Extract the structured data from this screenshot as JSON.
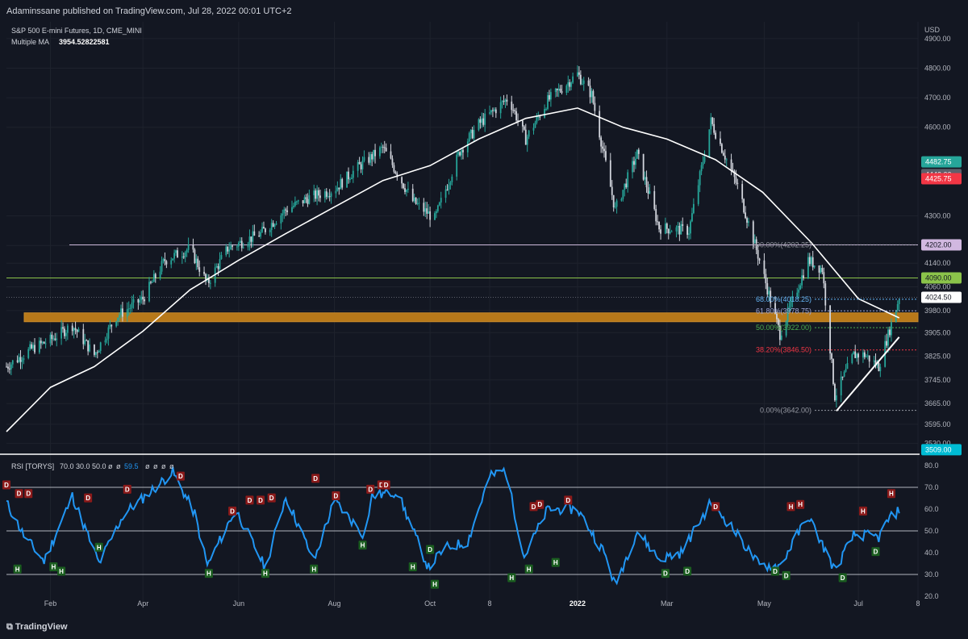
{
  "header": {
    "publisher_line": "Adaminssane published on TradingView.com, Jul 28, 2022 00:01 UTC+2"
  },
  "footer": {
    "logo_text": "TradingView"
  },
  "colors": {
    "background": "#131722",
    "grid": "#1e222d",
    "axis_text": "#b2b5be",
    "up_candle": "#26a69a",
    "down_candle": "#d1d4dc",
    "ma_line": "#ffffff",
    "rsi_line": "#2196f3",
    "zone_fill": "#b8791a",
    "green_level": "#8bc34a",
    "pink_level": "#c8b4d6",
    "fib_0": "#9598a1",
    "fib_382": "#f23645",
    "fib_50": "#4caf50",
    "fib_618": "#9fa8da",
    "fib_68": "#64b5f6"
  },
  "chart_data": [
    {
      "type": "candlestick",
      "title": "S&P 500 E-mini Futures, 1D, CME_MINI",
      "indicator_label": "Multiple MA",
      "indicator_value": "3954.52822581",
      "currency": "USD",
      "ylim": [
        3510,
        4935
      ],
      "y_ticks": [
        "4900.00",
        "4800.00",
        "4700.00",
        "4600.00",
        "4300.00",
        "4200.00",
        "4140.00",
        "4060.00",
        "3980.00",
        "3905.00",
        "3825.00",
        "3745.00",
        "3665.00",
        "3595.00",
        "3530.00"
      ],
      "x_labels": [
        "Feb",
        "Apr",
        "Jun",
        "Aug",
        "Oct",
        "8",
        "2022",
        "Mar",
        "May",
        "Jul",
        "8"
      ],
      "price_badges": [
        {
          "label": "4482.75",
          "value": 4482.75,
          "color": "#26a69a"
        },
        {
          "label": "4440.00",
          "value": 4440.0,
          "color": "#5d606b"
        },
        {
          "label": "4425.75",
          "value": 4425.75,
          "color": "#f23645"
        },
        {
          "label": "4202.00",
          "value": 4202.0,
          "color": "#d1b8e0"
        },
        {
          "label": "4090.00",
          "value": 4090.0,
          "color": "#8bc34a"
        },
        {
          "label": "4024.50",
          "value": 4024.5,
          "color": "#ffffff"
        },
        {
          "label": "3509.00",
          "value": 3509.0,
          "color": "#00bcd4"
        }
      ],
      "horizontal_levels": [
        {
          "value": 4202.0,
          "color": "#c8b4d6"
        },
        {
          "value": 4090.0,
          "color": "#8bc34a"
        },
        {
          "value": 4024.5,
          "color": "#5d606b"
        }
      ],
      "support_zone": {
        "low": 3942,
        "high": 3972
      },
      "fib_levels": [
        {
          "label": "100.00%(4202.25)",
          "value": 4202.25
        },
        {
          "label": "68.00%(4018.25)",
          "value": 4018.25
        },
        {
          "label": "61.80%(3978.75)",
          "value": 3978.75
        },
        {
          "label": "50.00%(3922.00)",
          "value": 3922.0
        },
        {
          "label": "38.20%(3846.50)",
          "value": 3846.5
        },
        {
          "label": "0.00%(3642.00)",
          "value": 3642.0
        }
      ],
      "trendline": {
        "from": {
          "x": "2022-06-17",
          "y": 3640
        },
        "to": {
          "x": "2022-07-27",
          "y": 3890
        }
      },
      "series": [
        {
          "name": "Multiple MA",
          "points": [
            [
              "2021-01-04",
              3570
            ],
            [
              "2021-02-01",
              3720
            ],
            [
              "2021-03-01",
              3790
            ],
            [
              "2021-04-01",
              3910
            ],
            [
              "2021-05-01",
              4050
            ],
            [
              "2021-06-01",
              4150
            ],
            [
              "2021-07-01",
              4240
            ],
            [
              "2021-08-01",
              4330
            ],
            [
              "2021-09-01",
              4420
            ],
            [
              "2021-10-01",
              4470
            ],
            [
              "2021-11-01",
              4560
            ],
            [
              "2021-12-01",
              4630
            ],
            [
              "2022-01-03",
              4665
            ],
            [
              "2022-02-01",
              4600
            ],
            [
              "2022-03-01",
              4560
            ],
            [
              "2022-04-01",
              4490
            ],
            [
              "2022-05-01",
              4380
            ],
            [
              "2022-06-01",
              4210
            ],
            [
              "2022-07-01",
              4020
            ],
            [
              "2022-07-27",
              3955
            ]
          ]
        },
        {
          "name": "Close",
          "points": [
            [
              "2021-01-04",
              3790
            ],
            [
              "2021-01-20",
              3850
            ],
            [
              "2021-02-01",
              3880
            ],
            [
              "2021-02-15",
              3930
            ],
            [
              "2021-03-01",
              3830
            ],
            [
              "2021-03-15",
              3960
            ],
            [
              "2021-04-01",
              4020
            ],
            [
              "2021-04-15",
              4150
            ],
            [
              "2021-05-01",
              4190
            ],
            [
              "2021-05-12",
              4070
            ],
            [
              "2021-05-25",
              4190
            ],
            [
              "2021-06-15",
              4240
            ],
            [
              "2021-07-01",
              4320
            ],
            [
              "2021-07-15",
              4360
            ],
            [
              "2021-08-01",
              4390
            ],
            [
              "2021-08-15",
              4460
            ],
            [
              "2021-09-01",
              4530
            ],
            [
              "2021-09-20",
              4350
            ],
            [
              "2021-10-04",
              4290
            ],
            [
              "2021-10-20",
              4520
            ],
            [
              "2021-11-01",
              4610
            ],
            [
              "2021-11-20",
              4700
            ],
            [
              "2021-12-01",
              4560
            ],
            [
              "2021-12-15",
              4690
            ],
            [
              "2022-01-03",
              4780
            ],
            [
              "2022-01-12",
              4710
            ],
            [
              "2022-01-27",
              4320
            ],
            [
              "2022-02-10",
              4510
            ],
            [
              "2022-02-24",
              4260
            ],
            [
              "2022-03-15",
              4250
            ],
            [
              "2022-03-29",
              4620
            ],
            [
              "2022-04-15",
              4400
            ],
            [
              "2022-04-29",
              4150
            ],
            [
              "2022-05-12",
              3900
            ],
            [
              "2022-05-30",
              4150
            ],
            [
              "2022-06-08",
              4120
            ],
            [
              "2022-06-16",
              3690
            ],
            [
              "2022-06-28",
              3830
            ],
            [
              "2022-07-05",
              3830
            ],
            [
              "2022-07-14",
              3790
            ],
            [
              "2022-07-27",
              4024.5
            ]
          ]
        }
      ]
    },
    {
      "type": "line",
      "title": "RSI [TORYS]",
      "params": [
        "70.0",
        "30.0",
        "50.0",
        "ø",
        "ø"
      ],
      "current_value": "59.5",
      "params_tail": [
        "ø",
        "ø",
        "ø",
        "ø"
      ],
      "ylim": [
        17,
        83
      ],
      "y_ticks": [
        "80.0",
        "70.0",
        "60.0",
        "50.0",
        "40.0",
        "30.0",
        "20.0"
      ],
      "levels": [
        70,
        50,
        30
      ],
      "series": [
        {
          "name": "RSI",
          "points": [
            [
              "2021-01-04",
              63
            ],
            [
              "2021-01-15",
              48
            ],
            [
              "2021-01-28",
              36
            ],
            [
              "2021-02-15",
              66
            ],
            [
              "2021-03-04",
              35
            ],
            [
              "2021-03-20",
              58
            ],
            [
              "2021-04-01",
              65
            ],
            [
              "2021-04-20",
              77
            ],
            [
              "2021-05-04",
              58
            ],
            [
              "2021-05-12",
              34
            ],
            [
              "2021-05-30",
              60
            ],
            [
              "2021-06-18",
              33
            ],
            [
              "2021-07-01",
              66
            ],
            [
              "2021-07-19",
              36
            ],
            [
              "2021-08-01",
              64
            ],
            [
              "2021-08-20",
              48
            ],
            [
              "2021-08-25",
              66
            ],
            [
              "2021-09-10",
              68
            ],
            [
              "2021-09-30",
              33
            ],
            [
              "2021-10-10",
              42
            ],
            [
              "2021-10-25",
              45
            ],
            [
              "2021-11-08",
              75
            ],
            [
              "2021-11-18",
              78
            ],
            [
              "2021-11-30",
              38
            ],
            [
              "2021-12-15",
              60
            ],
            [
              "2022-01-03",
              60
            ],
            [
              "2022-01-20",
              40
            ],
            [
              "2022-01-27",
              25
            ],
            [
              "2022-02-10",
              50
            ],
            [
              "2022-02-24",
              37
            ],
            [
              "2022-03-10",
              40
            ],
            [
              "2022-03-29",
              63
            ],
            [
              "2022-04-11",
              52
            ],
            [
              "2022-04-29",
              34
            ],
            [
              "2022-05-12",
              34
            ],
            [
              "2022-05-30",
              57
            ],
            [
              "2022-06-16",
              32
            ],
            [
              "2022-06-28",
              48
            ],
            [
              "2022-07-05",
              48
            ],
            [
              "2022-07-14",
              47
            ],
            [
              "2022-07-20",
              55
            ],
            [
              "2022-07-27",
              59.5
            ]
          ]
        }
      ],
      "signals": [
        {
          "x": "2021-01-04",
          "label": "D",
          "value": 68
        },
        {
          "x": "2021-01-12",
          "label": "D",
          "value": 64
        },
        {
          "x": "2021-01-18",
          "label": "D",
          "value": 64
        },
        {
          "x": "2021-02-25",
          "label": "D",
          "value": 62
        },
        {
          "x": "2021-03-22",
          "label": "D",
          "value": 66
        },
        {
          "x": "2021-04-25",
          "label": "D",
          "value": 72
        },
        {
          "x": "2021-05-28",
          "label": "D",
          "value": 56
        },
        {
          "x": "2021-06-08",
          "label": "D",
          "value": 61
        },
        {
          "x": "2021-06-15",
          "label": "D",
          "value": 61
        },
        {
          "x": "2021-06-22",
          "label": "D",
          "value": 62
        },
        {
          "x": "2021-07-20",
          "label": "D",
          "value": 71
        },
        {
          "x": "2021-08-02",
          "label": "D",
          "value": 63
        },
        {
          "x": "2021-08-24",
          "label": "D",
          "value": 66
        },
        {
          "x": "2021-08-31",
          "label": "D",
          "value": 68
        },
        {
          "x": "2021-09-03",
          "label": "D",
          "value": 68
        },
        {
          "x": "2021-10-01",
          "label": "D",
          "value": 45
        },
        {
          "x": "2021-12-06",
          "label": "D",
          "value": 58
        },
        {
          "x": "2021-12-10",
          "label": "D",
          "value": 59
        },
        {
          "x": "2021-12-28",
          "label": "D",
          "value": 61
        },
        {
          "x": "2022-04-01",
          "label": "D",
          "value": 58
        },
        {
          "x": "2021-01-11",
          "label": "H",
          "value": 36
        },
        {
          "x": "2021-02-03",
          "label": "H",
          "value": 37
        },
        {
          "x": "2021-02-08",
          "label": "H",
          "value": 35
        },
        {
          "x": "2021-03-04",
          "label": "H",
          "value": 46
        },
        {
          "x": "2021-05-13",
          "label": "H",
          "value": 34
        },
        {
          "x": "2021-06-18",
          "label": "H",
          "value": 34
        },
        {
          "x": "2021-07-19",
          "label": "H",
          "value": 36
        },
        {
          "x": "2021-08-19",
          "label": "H",
          "value": 47
        },
        {
          "x": "2021-09-20",
          "label": "H",
          "value": 37
        },
        {
          "x": "2021-10-04",
          "label": "H",
          "value": 29
        },
        {
          "x": "2021-11-22",
          "label": "H",
          "value": 32
        },
        {
          "x": "2021-12-03",
          "label": "H",
          "value": 36
        },
        {
          "x": "2021-12-20",
          "label": "H",
          "value": 39
        },
        {
          "x": "2022-05-19",
          "label": "H",
          "value": 58
        },
        {
          "x": "2022-05-25",
          "label": "H",
          "value": 59
        },
        {
          "x": "2022-07-04",
          "label": "H",
          "value": 56
        },
        {
          "x": "2022-07-22",
          "label": "H",
          "value": 64
        },
        {
          "x": "2022-02-28",
          "label": "D",
          "value": 34
        },
        {
          "x": "2022-03-14",
          "label": "D",
          "value": 35
        },
        {
          "x": "2022-05-09",
          "label": "D",
          "value": 35
        },
        {
          "x": "2022-05-16",
          "label": "D",
          "value": 33
        },
        {
          "x": "2022-06-21",
          "label": "D",
          "value": 32
        },
        {
          "x": "2022-07-12",
          "label": "D",
          "value": 44
        }
      ]
    }
  ]
}
